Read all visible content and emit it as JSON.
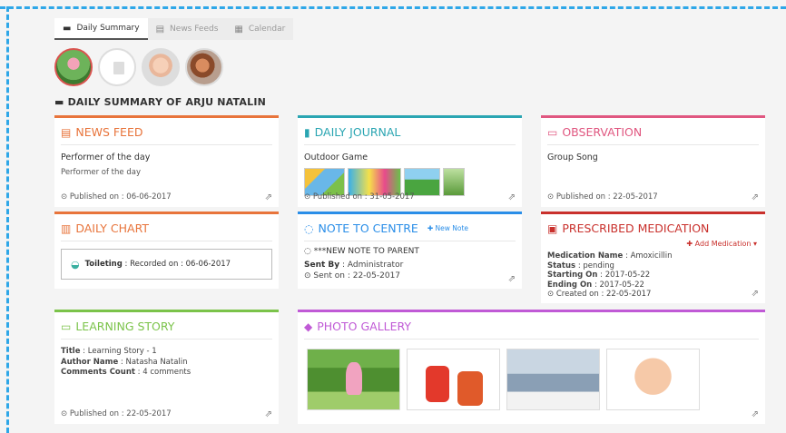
{
  "tabs": [
    {
      "label": "Daily Summary",
      "icon": "summary-icon",
      "active": true
    },
    {
      "label": "News Feeds",
      "icon": "newspaper-icon",
      "active": false
    },
    {
      "label": "Calendar",
      "icon": "calendar-icon",
      "active": false
    }
  ],
  "summary_title": "DAILY SUMMARY OF ARJU NATALIN",
  "news_feed": {
    "title": "NEWS FEED",
    "heading": "Performer of the day",
    "text": "Performer of the day",
    "published": "Published on : 06-06-2017"
  },
  "daily_journal": {
    "title": "DAILY JOURNAL",
    "heading": "Outdoor Game",
    "published": "Published on : 31-05-2017"
  },
  "observation": {
    "title": "OBSERVATION",
    "heading": "Group Song",
    "published": "Published on : 22-05-2017"
  },
  "daily_chart": {
    "title": "DAILY CHART",
    "item_label": "Toileting",
    "item_text": ": Recorded on : 06-06-2017"
  },
  "note_to_centre": {
    "title": "NOTE TO CENTRE",
    "new_note_label": "New Note",
    "note_title": "***NEW NOTE TO PARENT",
    "sent_by_label": "Sent By",
    "sent_by_value": ": Administrator",
    "sent_on": "Sent on : 22-05-2017"
  },
  "prescribed_medication": {
    "title": "PRESCRIBED MEDICATION",
    "add_label": "Add Medication",
    "rows": [
      {
        "label": "Medication Name",
        "value": ": Amoxicillin"
      },
      {
        "label": "Status",
        "value": ": pending"
      },
      {
        "label": "Starting On",
        "value": ": 2017-05-22"
      },
      {
        "label": "Ending On",
        "value": ": 2017-05-22"
      }
    ],
    "created": "Created on : 22-05-2017"
  },
  "learning_story": {
    "title": "LEARNING STORY",
    "rows": [
      {
        "label": "Title",
        "value": ": Learning Story - 1"
      },
      {
        "label": "Author Name",
        "value": ": Natasha Natalin"
      },
      {
        "label": "Comments Count",
        "value": ": 4 comments"
      }
    ],
    "published": "Published on : 22-05-2017"
  },
  "photo_gallery": {
    "title": "PHOTO GALLERY"
  },
  "colors": {
    "accent_dash": "#2ea7e8",
    "news": "#e8743b",
    "journal": "#2aa5b2",
    "observation": "#e05780",
    "note": "#2a8ee8",
    "medication": "#c9302c",
    "story": "#7bc34a",
    "gallery": "#c05ad6"
  }
}
